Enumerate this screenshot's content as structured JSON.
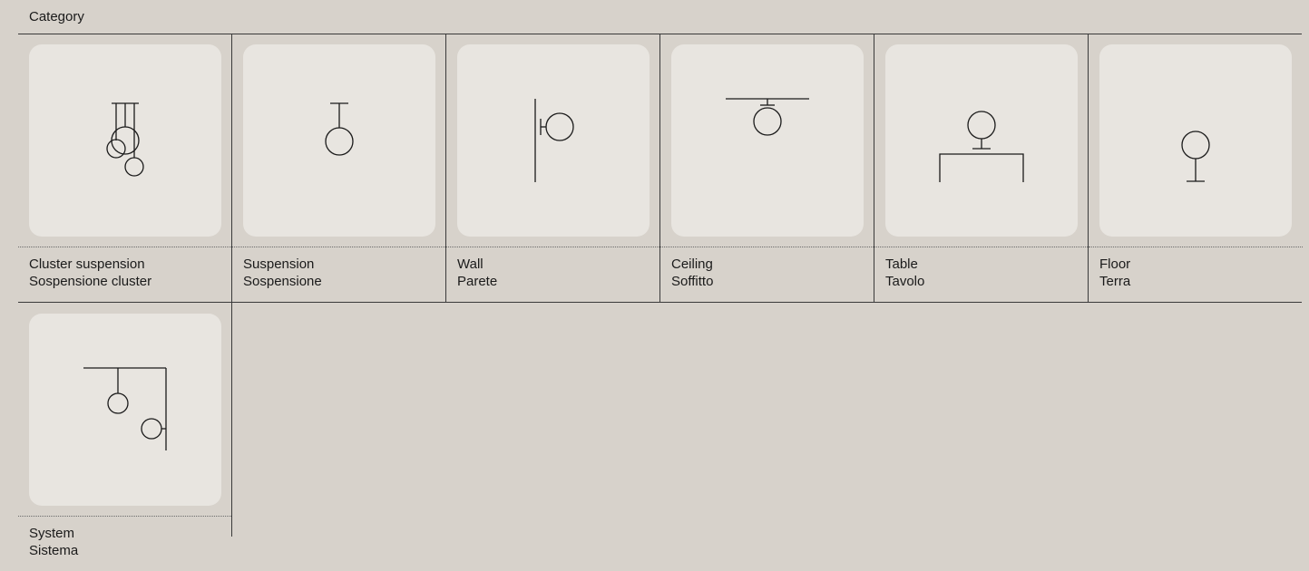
{
  "header": {
    "title": "Category"
  },
  "categories": [
    {
      "en": "Cluster suspension",
      "it": "Sospensione cluster",
      "icon": "cluster-suspension-lamp-icon"
    },
    {
      "en": "Suspension",
      "it": "Sospensione",
      "icon": "suspension-lamp-icon"
    },
    {
      "en": "Wall",
      "it": "Parete",
      "icon": "wall-lamp-icon"
    },
    {
      "en": "Ceiling",
      "it": "Soffitto",
      "icon": "ceiling-lamp-icon"
    },
    {
      "en": "Table",
      "it": "Tavolo",
      "icon": "table-lamp-icon"
    },
    {
      "en": "Floor",
      "it": "Terra",
      "icon": "floor-lamp-icon"
    },
    {
      "en": "System",
      "it": "Sistema",
      "icon": "system-lamp-icon"
    }
  ]
}
